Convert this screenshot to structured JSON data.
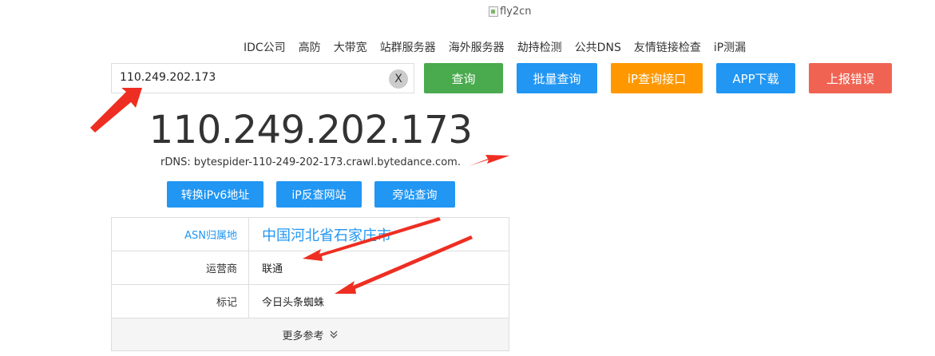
{
  "logo": {
    "alt_text": "fly2cn"
  },
  "nav": [
    "IDC公司",
    "高防",
    "大带宽",
    "站群服务器",
    "海外服务器",
    "劫持检测",
    "公共DNS",
    "友情链接检查",
    "iP测漏"
  ],
  "search": {
    "value": "110.249.202.173",
    "clear_label": "X"
  },
  "actions": {
    "query": "查询",
    "batch": "批量查询",
    "api": "iP查询接口",
    "app": "APP下载",
    "report": "上报错误"
  },
  "result": {
    "ip": "110.249.202.173",
    "rdns": "rDNS: bytespider-110-249-202-173.crawl.bytedance.com."
  },
  "tools": {
    "ipv6": "转换iPv6地址",
    "reverse": "iP反查网站",
    "side": "旁站查询"
  },
  "info": {
    "asn_label": "ASN归属地",
    "asn_value": "中国河北省石家庄市",
    "isp_label": "运营商",
    "isp_value": "联通",
    "tag_label": "标记",
    "tag_value": "今日头条蜘蛛",
    "more_label": "更多参考"
  },
  "colors": {
    "green": "#4aaa4e",
    "blue": "#2196f3",
    "orange": "#ff9800",
    "red": "#f06352",
    "annotation": "#ee2e22"
  }
}
